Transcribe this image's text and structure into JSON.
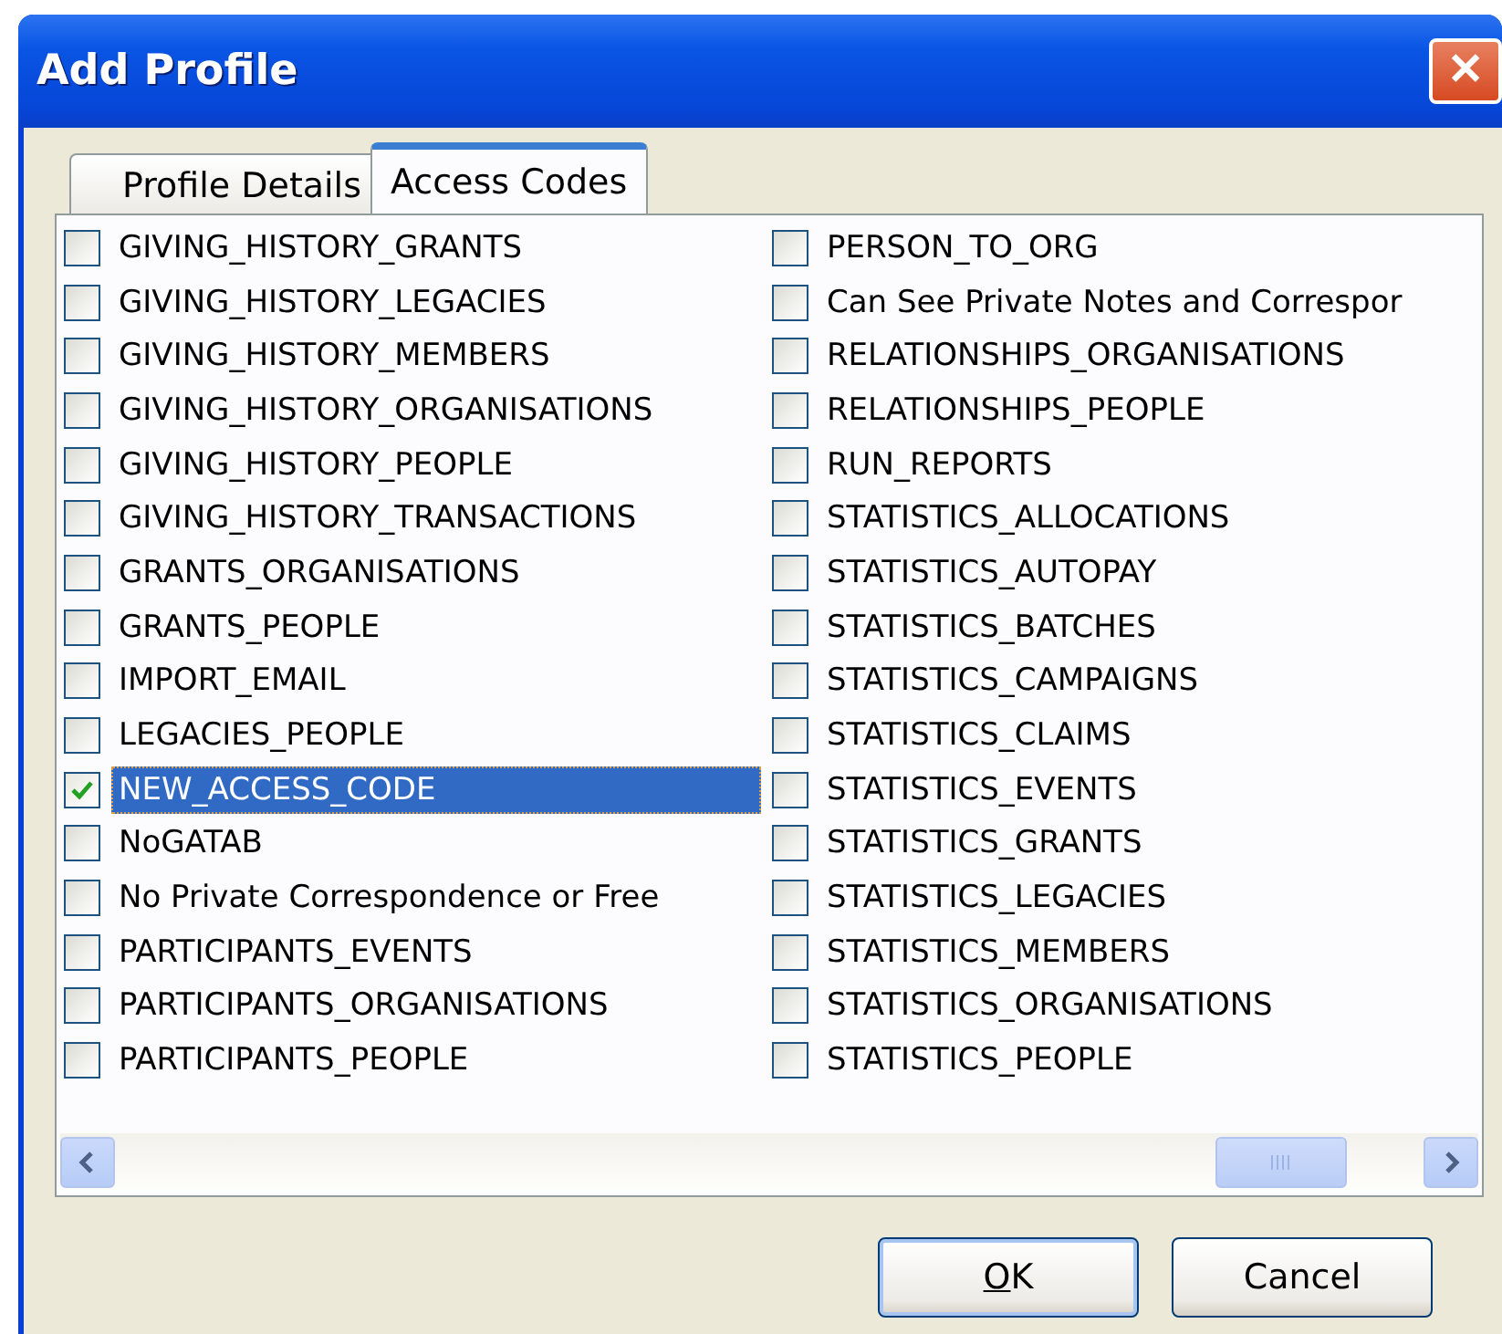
{
  "window": {
    "title": "Add Profile",
    "close": "✕"
  },
  "tabs": [
    {
      "label": "Profile Details",
      "selected": false
    },
    {
      "label": "Access Codes",
      "selected": true
    }
  ],
  "columns": [
    [
      {
        "label": "GIVING_HISTORY_GRANTS",
        "checked": false,
        "selected": false
      },
      {
        "label": "GIVING_HISTORY_LEGACIES",
        "checked": false,
        "selected": false
      },
      {
        "label": "GIVING_HISTORY_MEMBERS",
        "checked": false,
        "selected": false
      },
      {
        "label": "GIVING_HISTORY_ORGANISATIONS",
        "checked": false,
        "selected": false
      },
      {
        "label": "GIVING_HISTORY_PEOPLE",
        "checked": false,
        "selected": false
      },
      {
        "label": "GIVING_HISTORY_TRANSACTIONS",
        "checked": false,
        "selected": false
      },
      {
        "label": "GRANTS_ORGANISATIONS",
        "checked": false,
        "selected": false
      },
      {
        "label": "GRANTS_PEOPLE",
        "checked": false,
        "selected": false
      },
      {
        "label": "IMPORT_EMAIL",
        "checked": false,
        "selected": false
      },
      {
        "label": "LEGACIES_PEOPLE",
        "checked": false,
        "selected": false
      },
      {
        "label": "NEW_ACCESS_CODE",
        "checked": true,
        "selected": true
      },
      {
        "label": "NoGATAB",
        "checked": false,
        "selected": false
      },
      {
        "label": "No Private Correspondence or Free",
        "checked": false,
        "selected": false
      },
      {
        "label": "PARTICIPANTS_EVENTS",
        "checked": false,
        "selected": false
      },
      {
        "label": "PARTICIPANTS_ORGANISATIONS",
        "checked": false,
        "selected": false
      },
      {
        "label": "PARTICIPANTS_PEOPLE",
        "checked": false,
        "selected": false
      }
    ],
    [
      {
        "label": "PERSON_TO_ORG",
        "checked": false,
        "selected": false
      },
      {
        "label": "Can See Private Notes and Correspor",
        "checked": false,
        "selected": false
      },
      {
        "label": "RELATIONSHIPS_ORGANISATIONS",
        "checked": false,
        "selected": false
      },
      {
        "label": "RELATIONSHIPS_PEOPLE",
        "checked": false,
        "selected": false
      },
      {
        "label": "RUN_REPORTS",
        "checked": false,
        "selected": false
      },
      {
        "label": "STATISTICS_ALLOCATIONS",
        "checked": false,
        "selected": false
      },
      {
        "label": "STATISTICS_AUTOPAY",
        "checked": false,
        "selected": false
      },
      {
        "label": "STATISTICS_BATCHES",
        "checked": false,
        "selected": false
      },
      {
        "label": "STATISTICS_CAMPAIGNS",
        "checked": false,
        "selected": false
      },
      {
        "label": "STATISTICS_CLAIMS",
        "checked": false,
        "selected": false
      },
      {
        "label": "STATISTICS_EVENTS",
        "checked": false,
        "selected": false
      },
      {
        "label": "STATISTICS_GRANTS",
        "checked": false,
        "selected": false
      },
      {
        "label": "STATISTICS_LEGACIES",
        "checked": false,
        "selected": false
      },
      {
        "label": "STATISTICS_MEMBERS",
        "checked": false,
        "selected": false
      },
      {
        "label": "STATISTICS_ORGANISATIONS",
        "checked": false,
        "selected": false
      },
      {
        "label": "STATISTICS_PEOPLE",
        "checked": false,
        "selected": false
      }
    ]
  ],
  "buttons": [
    {
      "label": "OK",
      "default": true,
      "underline_first": true
    },
    {
      "label": "Cancel",
      "default": false,
      "underline_first": false
    }
  ]
}
